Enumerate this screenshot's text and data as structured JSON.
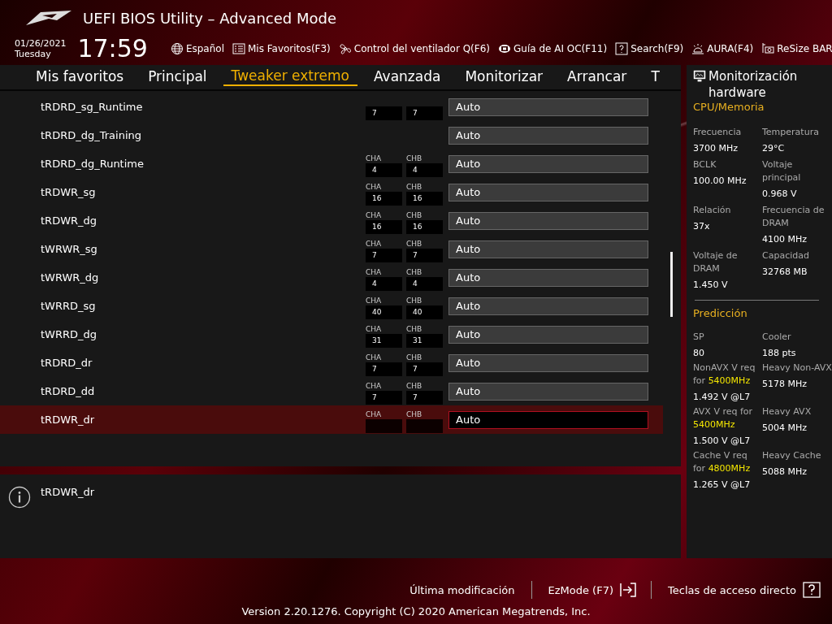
{
  "header": {
    "title": "UEFI BIOS Utility – Advanced Mode",
    "date": "01/26/2021",
    "day": "Tuesday",
    "time": "17:59",
    "tools": [
      {
        "kind": "globe",
        "label": "Español"
      },
      {
        "kind": "list",
        "label": "Mis Favoritos(F3)"
      },
      {
        "kind": "fan",
        "label": "Control del ventilador Q(F6)"
      },
      {
        "kind": "chip",
        "label": "Guía de AI OC(F11)"
      },
      {
        "kind": "help",
        "label": "Search(F9)"
      },
      {
        "kind": "light",
        "label": "AURA(F4)"
      },
      {
        "kind": "card",
        "label": "ReSize BAR"
      }
    ]
  },
  "tabs": [
    {
      "label": "Mis favoritos",
      "selected": false
    },
    {
      "label": "Principal",
      "selected": false
    },
    {
      "label": "Tweaker extremo",
      "selected": true
    },
    {
      "label": "Avanzada",
      "selected": false
    },
    {
      "label": "Monitorizar",
      "selected": false
    },
    {
      "label": "Arrancar",
      "selected": false
    },
    {
      "label": "T",
      "selected": false
    }
  ],
  "settings": [
    {
      "name": "tRDRD_sg_Runtime",
      "cha": "7",
      "chb": "7",
      "value": "Auto",
      "selected": false
    },
    {
      "name": "tRDRD_dg_Training",
      "value": "Auto",
      "selected": false
    },
    {
      "name": "tRDRD_dg_Runtime",
      "cha_label": "CHA",
      "chb_label": "CHB",
      "cha": "4",
      "chb": "4",
      "value": "Auto",
      "selected": false
    },
    {
      "name": "tRDWR_sg",
      "cha_label": "CHA",
      "chb_label": "CHB",
      "cha": "16",
      "chb": "16",
      "value": "Auto",
      "selected": false
    },
    {
      "name": "tRDWR_dg",
      "cha_label": "CHA",
      "chb_label": "CHB",
      "cha": "16",
      "chb": "16",
      "value": "Auto",
      "selected": false
    },
    {
      "name": "tWRWR_sg",
      "cha_label": "CHA",
      "chb_label": "CHB",
      "cha": "7",
      "chb": "7",
      "value": "Auto",
      "selected": false
    },
    {
      "name": "tWRWR_dg",
      "cha_label": "CHA",
      "chb_label": "CHB",
      "cha": "4",
      "chb": "4",
      "value": "Auto",
      "selected": false
    },
    {
      "name": "tWRRD_sg",
      "cha_label": "CHA",
      "chb_label": "CHB",
      "cha": "40",
      "chb": "40",
      "value": "Auto",
      "selected": false
    },
    {
      "name": "tWRRD_dg",
      "cha_label": "CHA",
      "chb_label": "CHB",
      "cha": "31",
      "chb": "31",
      "value": "Auto",
      "selected": false
    },
    {
      "name": "tRDRD_dr",
      "cha_label": "CHA",
      "chb_label": "CHB",
      "cha": "7",
      "chb": "7",
      "value": "Auto",
      "selected": false
    },
    {
      "name": "tRDRD_dd",
      "cha_label": "CHA",
      "chb_label": "CHB",
      "cha": "7",
      "chb": "7",
      "value": "Auto",
      "selected": false
    },
    {
      "name": "tRDWR_dr",
      "cha_label": "CHA",
      "chb_label": "CHB",
      "value": "Auto",
      "selected": true
    }
  ],
  "help": {
    "text": "tRDWR_dr"
  },
  "monitor": {
    "title": "Monitorización hardware",
    "cpu_heading": "CPU/Memoria",
    "cpu": [
      {
        "label": "Frecuencia",
        "value": "3700 MHz"
      },
      {
        "label": "Temperatura",
        "value": "29°C"
      },
      {
        "label": "BCLK",
        "value": "100.00 MHz"
      },
      {
        "label": "Voltaje principal",
        "value": "0.968 V"
      },
      {
        "label": "Relación",
        "value": "37x"
      },
      {
        "label": "Frecuencia de DRAM",
        "value": "4100 MHz"
      },
      {
        "label": "Voltaje de DRAM",
        "value": "1.450 V"
      },
      {
        "label": "Capacidad",
        "value": "32768 MB"
      }
    ],
    "prediction_heading": "Predicción",
    "prediction": [
      {
        "label": "SP",
        "value": "80"
      },
      {
        "label": "Cooler",
        "value": "188 pts"
      },
      {
        "label": "NonAVX V req for",
        "highlight": "5400MHz",
        "value": "1.492 V @L7"
      },
      {
        "label": "Heavy Non-AVX",
        "value": "5178 MHz"
      },
      {
        "label": "AVX V req for",
        "highlight": "5400MHz",
        "value": "1.500 V @L7"
      },
      {
        "label": "Heavy AVX",
        "value": "5004 MHz"
      },
      {
        "label": "Cache V req for",
        "highlight": "4800MHz",
        "value": "1.265 V @L7"
      },
      {
        "label": "Heavy Cache",
        "value": "5088 MHz"
      }
    ]
  },
  "footer": {
    "last_modified": "Última modificación",
    "ezmode": "EzMode (F7)",
    "hotkeys": "Teclas de acceso directo",
    "version": "Version 2.20.1276. Copyright (C) 2020 American Megatrends, Inc."
  }
}
